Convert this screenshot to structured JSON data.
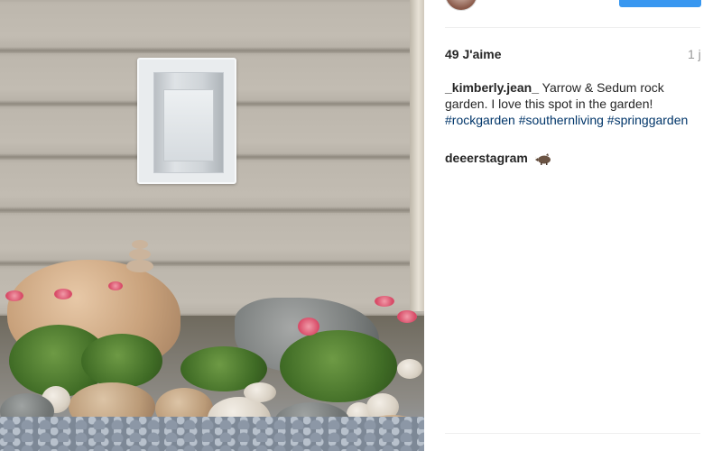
{
  "post": {
    "likes": "49 J'aime",
    "age": "1 j",
    "caption": {
      "username": "_kimberly.jean_",
      "text": "Yarrow & Sedum rock garden. I love this spot in the garden!",
      "hashtags": [
        "#rockgarden",
        "#southernliving",
        "#springgarden"
      ]
    },
    "comments": [
      {
        "username": "deeerstagram",
        "icon": "wild-boar-emoji-icon"
      }
    ]
  },
  "colors": {
    "link": "#003569",
    "button": "#3897f0",
    "text": "#262626",
    "muted": "#999999"
  }
}
